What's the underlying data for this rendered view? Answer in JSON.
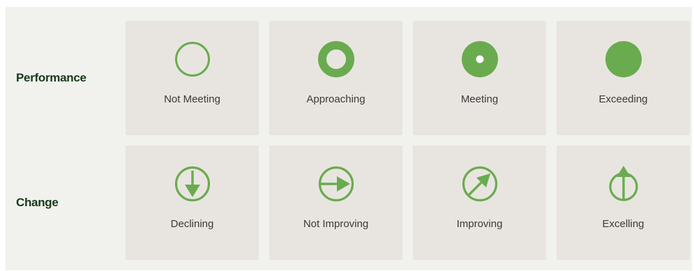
{
  "colors": {
    "accent": "#6aab4f",
    "panel_bg": "#f1f1ed",
    "card_bg": "#e8e5e0",
    "row_label": "#163a1a",
    "card_label": "#3a3a3a"
  },
  "performance": {
    "label": "Performance",
    "items": [
      {
        "label": "Not Meeting",
        "icon": "empty-circle-icon"
      },
      {
        "label": "Approaching",
        "icon": "ring-circle-icon"
      },
      {
        "label": "Meeting",
        "icon": "dot-circle-icon"
      },
      {
        "label": "Exceeding",
        "icon": "filled-circle-icon"
      }
    ]
  },
  "change": {
    "label": "Change",
    "items": [
      {
        "label": "Declining",
        "icon": "arrow-down-circle-icon"
      },
      {
        "label": "Not Improving",
        "icon": "arrow-right-circle-icon"
      },
      {
        "label": "Improving",
        "icon": "arrow-up-right-circle-icon"
      },
      {
        "label": "Excelling",
        "icon": "arrow-up-circle-icon"
      }
    ]
  }
}
